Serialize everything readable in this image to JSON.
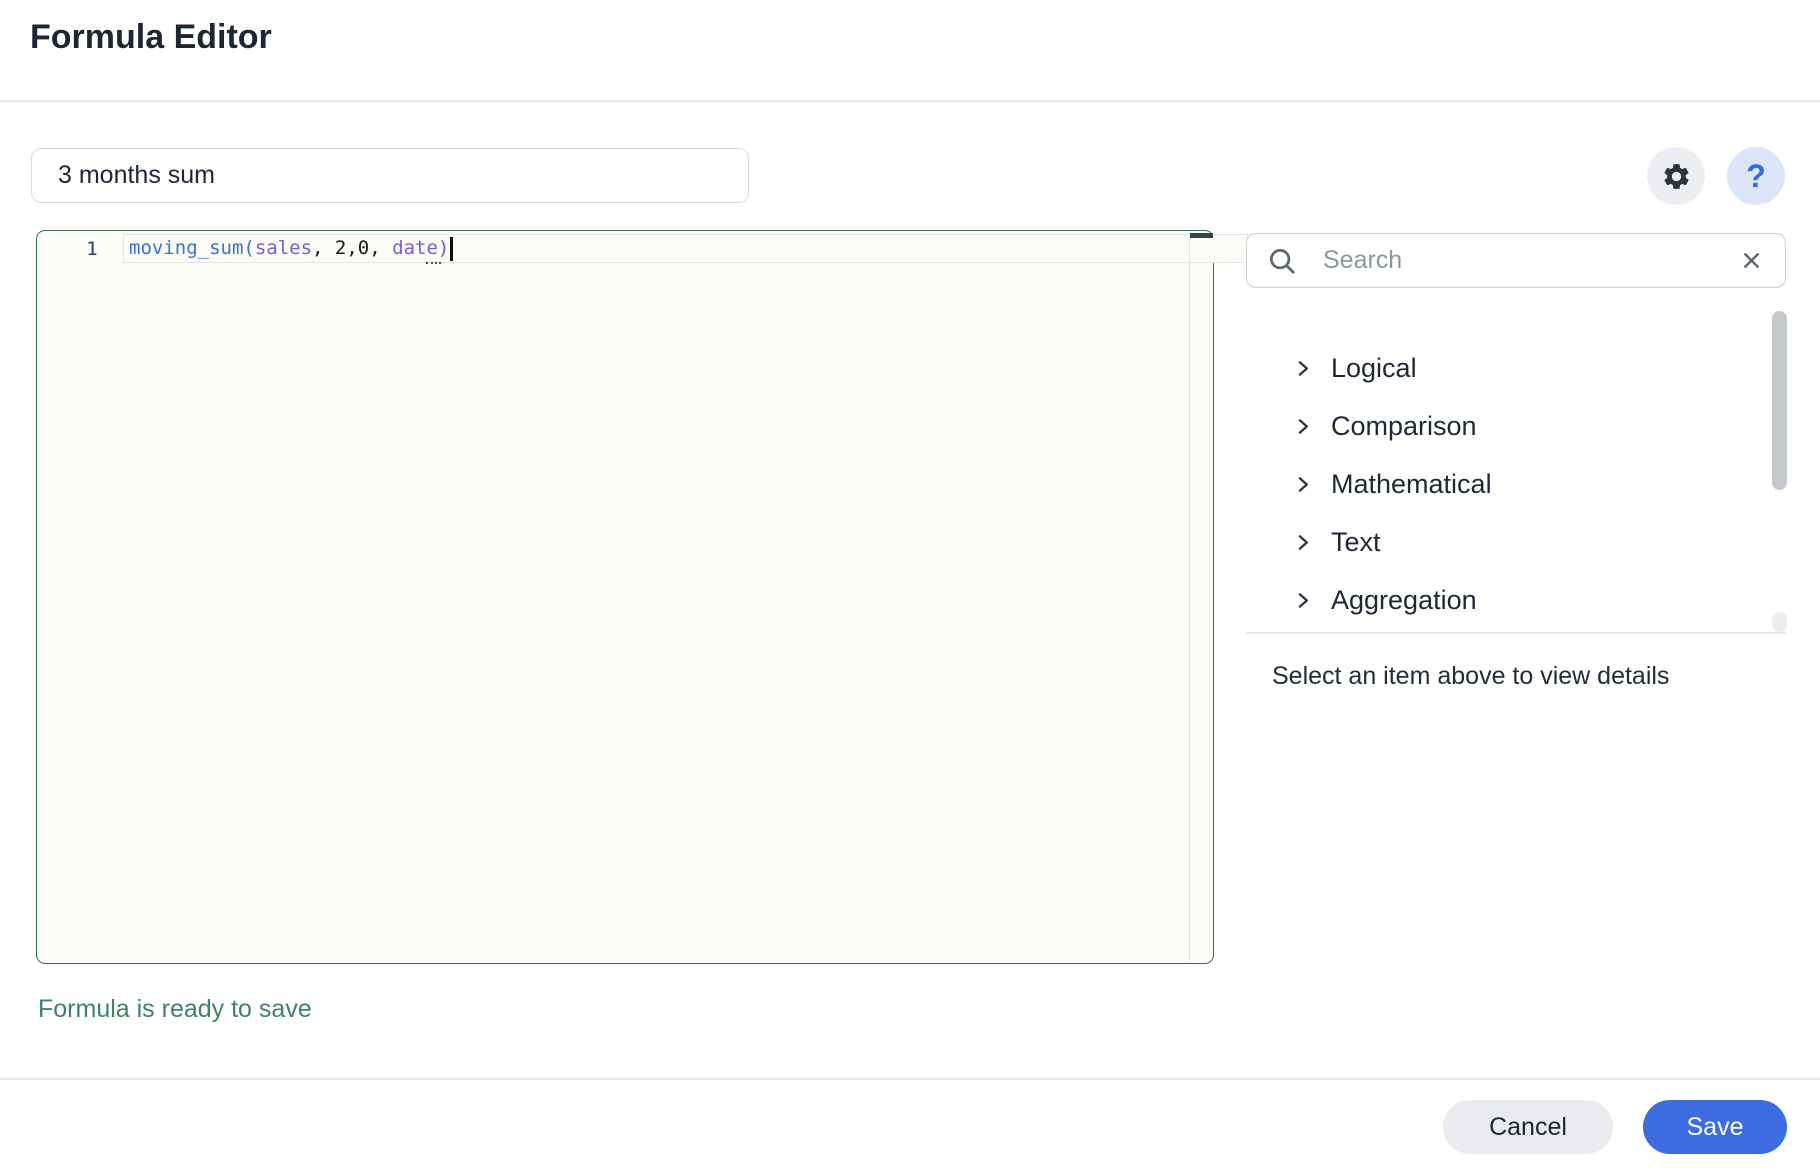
{
  "header": {
    "title": "Formula Editor"
  },
  "formula_name": {
    "value": "3 months sum"
  },
  "actions": {
    "settings_icon": "gear-icon",
    "help_icon": "question-mark-icon",
    "help_glyph": "?"
  },
  "editor": {
    "line_number": "1",
    "tokens": [
      {
        "text": "moving_sum(",
        "type": "function"
      },
      {
        "text": "sales",
        "type": "column"
      },
      {
        "text": ", 2,0, ",
        "type": "plain"
      },
      {
        "text": "date",
        "type": "column"
      },
      {
        "text": ")",
        "type": "bracket"
      }
    ],
    "status_message": "Formula is ready to save"
  },
  "function_panel": {
    "search": {
      "placeholder": "Search",
      "clear_icon": "close-icon"
    },
    "categories": [
      {
        "label": "Logical"
      },
      {
        "label": "Comparison"
      },
      {
        "label": "Mathematical"
      },
      {
        "label": "Text"
      },
      {
        "label": "Aggregation"
      }
    ],
    "details_hint": "Select an item above to view details"
  },
  "footer": {
    "cancel_label": "Cancel",
    "save_label": "Save"
  },
  "colors": {
    "accent_blue": "#3d6ce1",
    "success_green": "#3f8463",
    "editor_border_green": "#2f7156",
    "token_function_blue": "#3a70d8",
    "token_column_purple": "#7a5cd6",
    "token_bracket_purple": "#6a5dd4",
    "help_icon_blue": "#2f6ce0",
    "help_icon_bg": "#dce5f8",
    "settings_icon_bg": "#eceef1"
  }
}
